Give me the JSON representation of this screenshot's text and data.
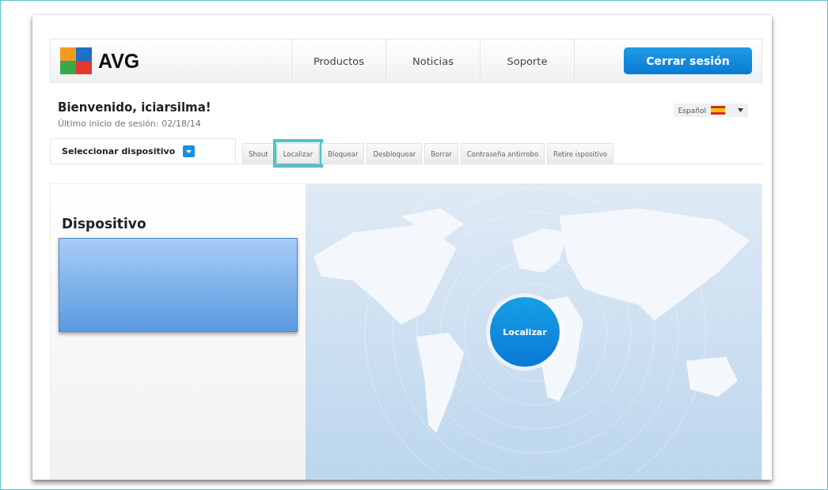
{
  "header": {
    "logo": "AVG",
    "nav": [
      "Productos",
      "Noticias",
      "Soporte"
    ],
    "logout_button": "Cerrar sesión"
  },
  "welcome": {
    "title": "Bienvenido, iciarsilma!",
    "last_login": "Último inicio de sesión: 02/18/14"
  },
  "language": {
    "value": "Español"
  },
  "device_selector": {
    "label": "Seleccionar dispositivo"
  },
  "actions": [
    {
      "label": "Shout",
      "highlighted": false
    },
    {
      "label": "Localizar",
      "highlighted": true
    },
    {
      "label": "Bloquear",
      "highlighted": false
    },
    {
      "label": "Desbloquear",
      "highlighted": false
    },
    {
      "label": "Borrar",
      "highlighted": false
    },
    {
      "label": "Contraseña antirrobo",
      "highlighted": false
    },
    {
      "label": "Retire ispositivo",
      "highlighted": false
    }
  ],
  "device_panel": {
    "title": "Dispositivo"
  },
  "map": {
    "locate_button": "Localizar"
  }
}
